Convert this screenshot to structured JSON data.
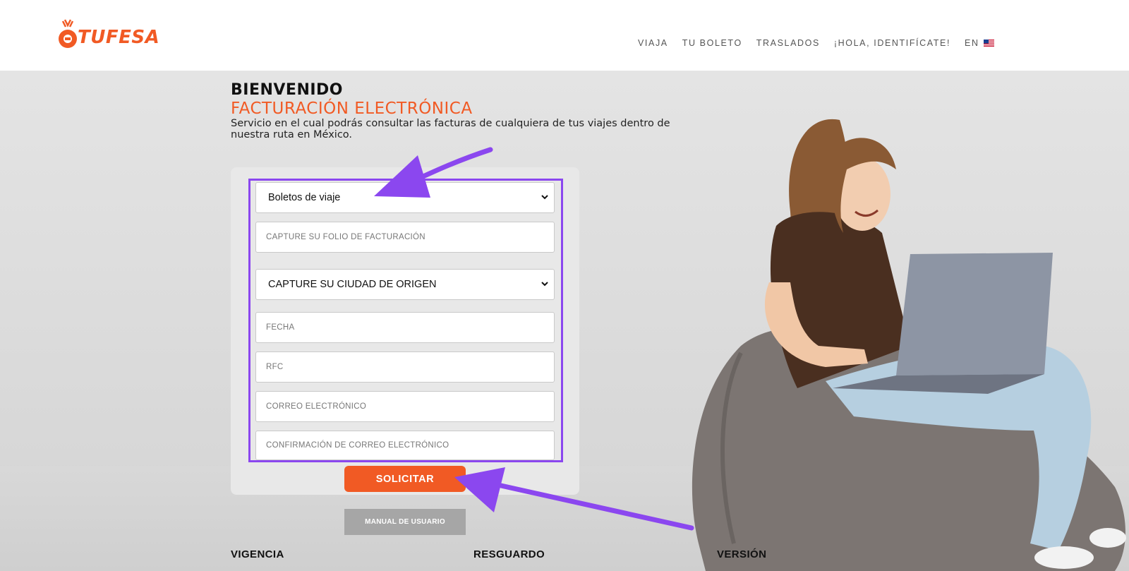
{
  "header": {
    "logo_text": "TUFESA",
    "nav": [
      {
        "label": "VIAJA"
      },
      {
        "label": "TU BOLETO"
      },
      {
        "label": "TRASLADOS"
      },
      {
        "label": "¡HOLA, IDENTIFÍCATE!"
      }
    ],
    "language": "EN"
  },
  "hero": {
    "welcome": "BIENVENIDO",
    "subtitle": "FACTURACIÓN ELECTRÓNICA",
    "description": "Servicio en el cual podrás consultar las facturas de cualquiera de tus viajes dentro de nuestra ruta en México."
  },
  "form": {
    "ticket_type_selected": "Boletos de viaje",
    "folio_placeholder": "CAPTURE SU FOLIO DE FACTURACIÓN",
    "origin_city_selected": "CAPTURE SU CIUDAD DE ORIGEN",
    "date_placeholder": "FECHA",
    "rfc_placeholder": "RFC",
    "email_placeholder": "CORREO ELECTRÓNICO",
    "email_confirm_placeholder": "CONFIRMACIÓN DE CORREO ELECTRÓNICO",
    "submit_label": "SOLICITAR",
    "manual_label": "MANUAL DE USUARIO"
  },
  "footer": {
    "columns": [
      "VIGENCIA",
      "RESGUARDO",
      "VERSIÓN"
    ]
  },
  "colors": {
    "brand_orange": "#f15a24",
    "highlight_purple": "#8b47ef",
    "manual_gray": "#a6a6a6"
  },
  "icons": [
    "tufesa-logo-icon",
    "us-flag-icon",
    "chevron-down-icon",
    "annotation-arrow-icon"
  ]
}
